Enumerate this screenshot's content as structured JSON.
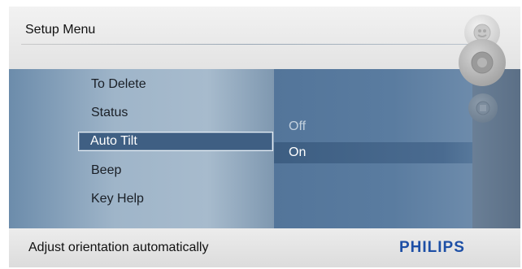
{
  "header": {
    "title": "Setup Menu"
  },
  "menu": {
    "items": [
      {
        "label": "To Delete",
        "selected": false
      },
      {
        "label": "Status",
        "selected": false
      },
      {
        "label": "Auto Tilt",
        "selected": true
      },
      {
        "label": "Beep",
        "selected": false
      },
      {
        "label": "Key Help",
        "selected": false
      }
    ]
  },
  "options": {
    "items": [
      {
        "label": "Off",
        "active": false
      },
      {
        "label": "On",
        "active": true
      }
    ]
  },
  "footer": {
    "hint": "Adjust orientation automatically",
    "brand": "PHILIPS"
  },
  "colors": {
    "brand": "#1d4fa6",
    "selection": "#3f5f83",
    "panel": "#a7bbcd"
  },
  "icons": {
    "top": "slideshow-icon",
    "mid": "photo-icon",
    "low": "settings-icon"
  }
}
